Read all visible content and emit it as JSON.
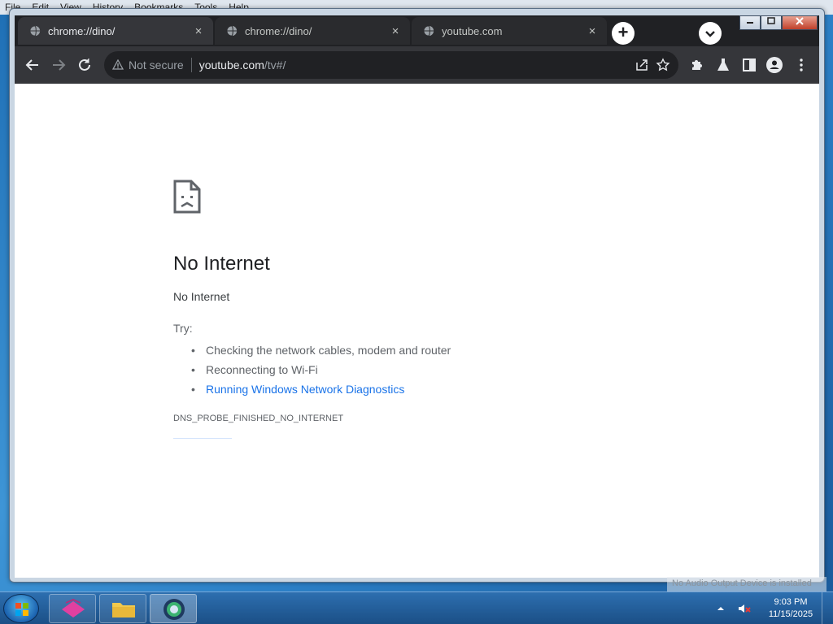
{
  "background_menu": [
    "File",
    "Edit",
    "View",
    "History",
    "Bookmarks",
    "Tools",
    "Help"
  ],
  "tabs": [
    {
      "title": "chrome://dino/",
      "active": true
    },
    {
      "title": "chrome://dino/",
      "active": false
    },
    {
      "title": "youtube.com",
      "active": false
    }
  ],
  "tab_close_glyph": "×",
  "new_tab_glyph": "+",
  "omnibox": {
    "security_label": "Not secure",
    "host": "youtube.com",
    "path": "/tv#/"
  },
  "error_page": {
    "title": "No Internet",
    "subtitle": "No Internet",
    "try_label": "Try:",
    "suggestions": [
      {
        "text": "Checking the network cables, modem and router",
        "link": false
      },
      {
        "text": "Reconnecting to Wi-Fi",
        "link": false
      },
      {
        "text": "Running Windows Network Diagnostics",
        "link": true
      }
    ],
    "error_code": "DNS_PROBE_FINISHED_NO_INTERNET"
  },
  "taskbar": {
    "time": "9:03 PM",
    "date": "11/15/2025",
    "notice": "No Audio Output Device is installed"
  },
  "colors": {
    "accent": "#1a73e8",
    "tab_bar": "#202124",
    "toolbar": "#35363a"
  }
}
